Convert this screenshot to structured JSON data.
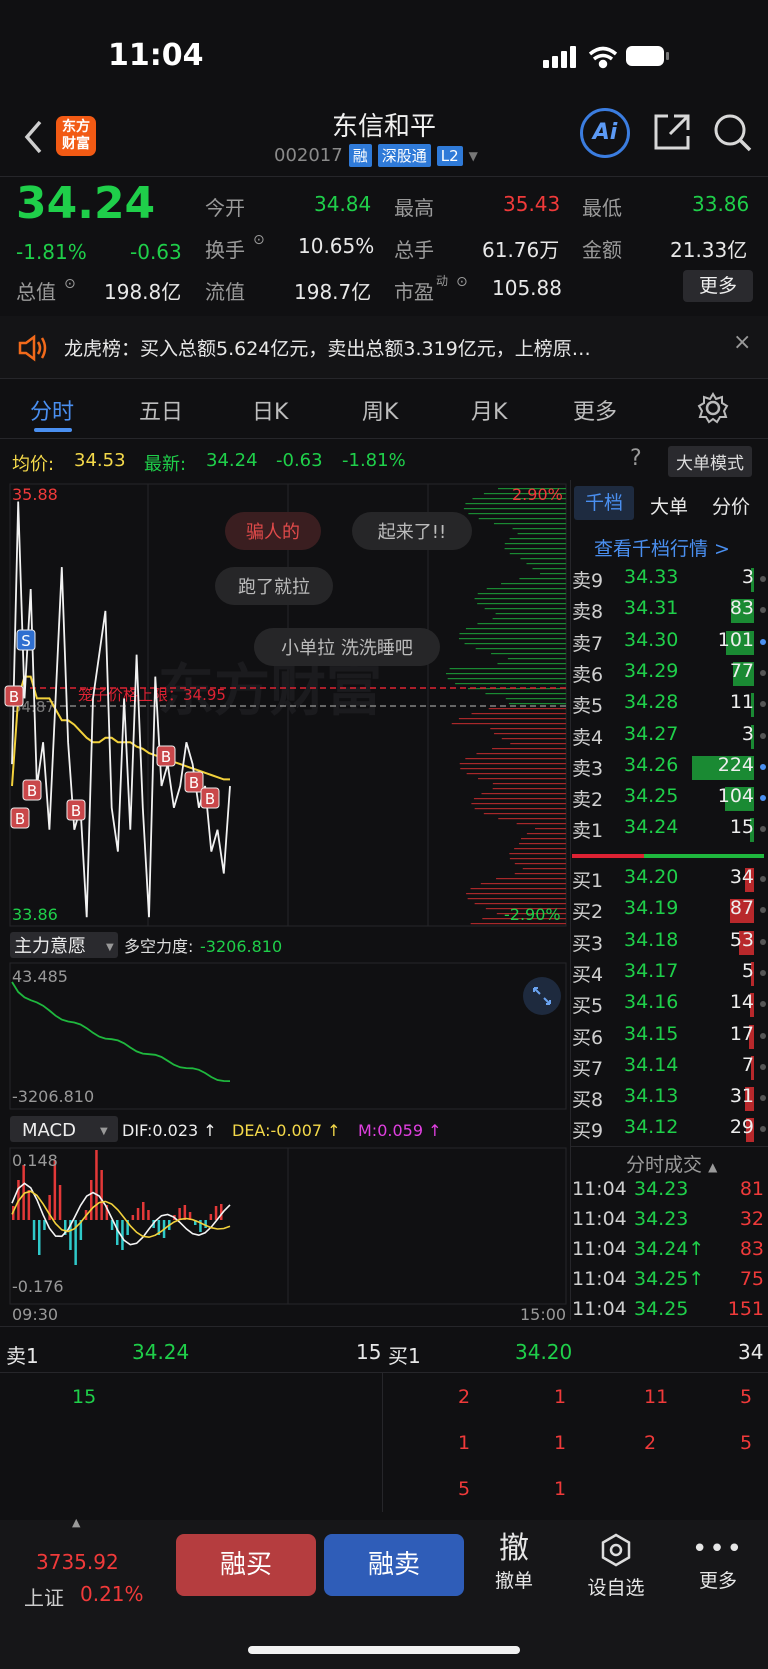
{
  "status": {
    "time": "11:04"
  },
  "header": {
    "name": "东信和平",
    "code": "002017",
    "tags": [
      "融",
      "深股通",
      "L2"
    ],
    "logo": "东方财富",
    "ai": "Ai"
  },
  "quote": {
    "price": "34.24",
    "pct": "-1.81%",
    "chg": "-0.63",
    "open_l": "今开",
    "open": "34.84",
    "high_l": "最高",
    "high": "35.43",
    "low_l": "最低",
    "low": "33.86",
    "turn_l": "换手",
    "turn": "10.65%",
    "vol_l": "总手",
    "vol": "61.76万",
    "amt_l": "金额",
    "amt": "21.33亿",
    "mcap_l": "总值",
    "mcap": "198.8亿",
    "float_l": "流值",
    "float": "198.7亿",
    "pe_l": "市盈",
    "pe_sup": "动",
    "pe": "105.88",
    "more": "更多"
  },
  "notice": "龙虎榜：买入总额5.624亿元，卖出总额3.319亿元，上榜原…",
  "tabs": [
    "分时",
    "五日",
    "日K",
    "周K",
    "月K",
    "更多"
  ],
  "pricebar": {
    "avg_l": "均价:",
    "avg": "34.53",
    "last_l": "最新:",
    "last": "34.24",
    "chg": "-0.63",
    "pct": "-1.81%",
    "bigmode": "大单模式"
  },
  "chart": {
    "ymax": "35.88",
    "ymin": "33.86",
    "pmax": "2.90%",
    "pmin": "-2.90%",
    "limit": "笼子价格上限：34.95",
    "ref": "34.87",
    "comments": [
      "骗人的",
      "起来了!!",
      "跑了就拉",
      "小单拉 洗洗睡吧"
    ],
    "ind1_name": "主力意愿",
    "ind1_label": "多空力度:",
    "ind1_val": "-3206.810",
    "ind1_max": "43.485",
    "ind1_min": "-3206.810",
    "macd_name": "MACD",
    "dif": "DIF:0.023 ↑",
    "dea": "DEA:-0.007 ↑",
    "m": "M:0.059 ↑",
    "macd_max": "0.148",
    "macd_min": "-0.176",
    "t_start": "09:30",
    "t_end": "15:00",
    "watermark": "东方财富"
  },
  "chart_data": {
    "type": "line",
    "title": "",
    "ylim": [
      33.86,
      35.88
    ],
    "x_range": [
      "09:30",
      "15:00"
    ],
    "series": [
      {
        "values": [
          34.6,
          35.8,
          34.9,
          35.4,
          34.5,
          34.7,
          34.3,
          34.9,
          35.5,
          34.7,
          34.3,
          34.4,
          33.9,
          34.9,
          35.1,
          35.3,
          34.4,
          34.2,
          34.9,
          34.3,
          35.1,
          34.4,
          33.9,
          35.0,
          34.5,
          34.6,
          34.4,
          34.5,
          34.7,
          34.6,
          34.4,
          34.5,
          34.2,
          34.3,
          34.1,
          34.5
        ]
      },
      {
        "values": [
          34.5,
          34.9,
          35.0,
          35.0,
          34.9,
          34.9,
          34.9,
          34.85,
          34.8,
          34.8,
          34.78,
          34.75,
          34.72,
          34.7,
          34.7,
          34.72,
          34.72,
          34.7,
          34.7,
          34.7,
          34.68,
          34.67,
          34.65,
          34.64,
          34.63,
          34.62,
          34.61,
          34.6,
          34.59,
          34.58,
          34.57,
          34.56,
          34.55,
          34.54,
          34.53,
          34.53
        ]
      }
    ]
  },
  "orderbook": {
    "tabs": [
      "千档",
      "大单",
      "分价"
    ],
    "link": "查看千档行情 >",
    "asks": [
      [
        "卖9",
        "34.33",
        "3"
      ],
      [
        "卖8",
        "34.31",
        "83"
      ],
      [
        "卖7",
        "34.30",
        "101"
      ],
      [
        "卖6",
        "34.29",
        "77"
      ],
      [
        "卖5",
        "34.28",
        "11"
      ],
      [
        "卖4",
        "34.27",
        "3"
      ],
      [
        "卖3",
        "34.26",
        "224"
      ],
      [
        "卖2",
        "34.25",
        "104"
      ],
      [
        "卖1",
        "34.24",
        "15"
      ]
    ],
    "bids": [
      [
        "买1",
        "34.20",
        "34"
      ],
      [
        "买2",
        "34.19",
        "87"
      ],
      [
        "买3",
        "34.18",
        "53"
      ],
      [
        "买4",
        "34.17",
        "5"
      ],
      [
        "买5",
        "34.16",
        "14"
      ],
      [
        "买6",
        "34.15",
        "17"
      ],
      [
        "买7",
        "34.14",
        "7"
      ],
      [
        "买8",
        "34.13",
        "31"
      ],
      [
        "买9",
        "34.12",
        "29"
      ]
    ],
    "ticks_title": "分时成交",
    "ticks": [
      [
        "11:04",
        "34.23",
        "81"
      ],
      [
        "11:04",
        "34.23",
        "32"
      ],
      [
        "11:04",
        "34.24↑",
        "83"
      ],
      [
        "11:04",
        "34.25↑",
        "75"
      ],
      [
        "11:04",
        "34.25",
        "151"
      ]
    ]
  },
  "queue": {
    "ask_l": "卖1",
    "ask_p": "34.24",
    "ask_v": "15",
    "bid_l": "买1",
    "bid_p": "34.20",
    "bid_v": "34",
    "ask_orders": [
      "15"
    ],
    "bid_orders": [
      "2",
      "1",
      "11",
      "5",
      "1",
      "1",
      "2",
      "5",
      "5",
      "1"
    ]
  },
  "bottom": {
    "index_val": "3735.92",
    "index_name": "上证",
    "index_pct": "0.21%",
    "buy": "融买",
    "sell": "融卖",
    "cancel_icon": "撤",
    "cancel": "撤单",
    "fav": "设自选",
    "more": "更多"
  }
}
